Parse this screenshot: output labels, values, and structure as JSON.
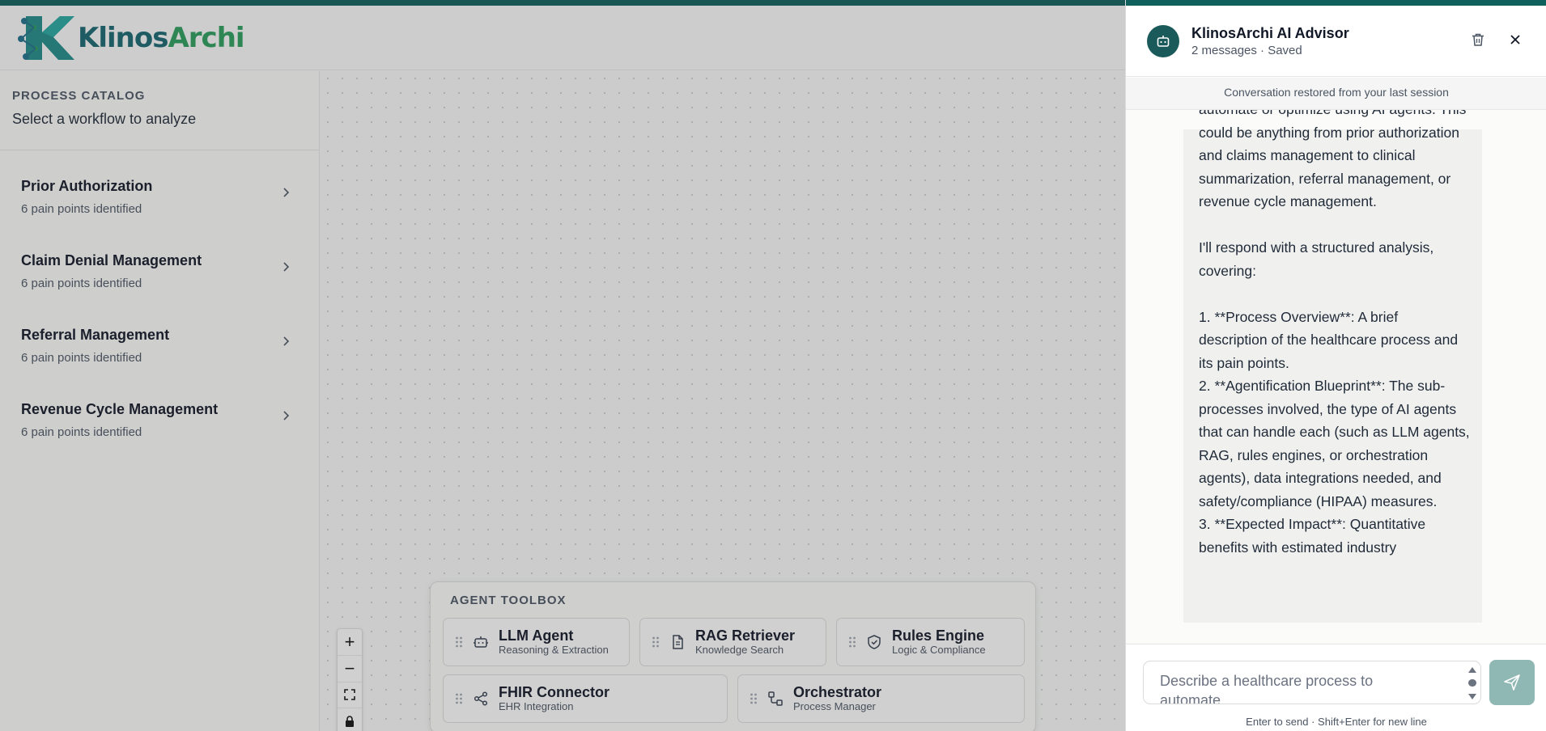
{
  "app": {
    "logo_text_a": "Klinos",
    "logo_text_b": "Archi"
  },
  "sidebar": {
    "kicker": "PROCESS CATALOG",
    "subtitle": "Select a workflow to analyze",
    "items": [
      {
        "title": "Prior Authorization",
        "meta": "6 pain points identified"
      },
      {
        "title": "Claim Denial Management",
        "meta": "6 pain points identified"
      },
      {
        "title": "Referral Management",
        "meta": "6 pain points identified"
      },
      {
        "title": "Revenue Cycle Management",
        "meta": "6 pain points identified"
      }
    ]
  },
  "zoom": {
    "zoom_in": "+",
    "zoom_out": "−"
  },
  "toolbox": {
    "title": "AGENT TOOLBOX",
    "tools": [
      {
        "name": "LLM Agent",
        "desc": "Reasoning & Extraction",
        "icon": "robot-icon"
      },
      {
        "name": "RAG Retriever",
        "desc": "Knowledge Search",
        "icon": "document-icon"
      },
      {
        "name": "Rules Engine",
        "desc": "Logic & Compliance",
        "icon": "shield-check-icon"
      },
      {
        "name": "FHIR Connector",
        "desc": "EHR Integration",
        "icon": "share-icon"
      },
      {
        "name": "Orchestrator",
        "desc": "Process Manager",
        "icon": "workflow-icon"
      }
    ]
  },
  "chat": {
    "title": "KlinosArchi AI Advisor",
    "status": "2 messages · Saved",
    "restored": "Conversation restored from your last session",
    "message": {
      "p1": "automate or optimize using AI agents. This could be anything from prior authorization and claims management to clinical summarization, referral management, or revenue cycle management.",
      "p2": "I'll respond with a structured analysis, covering:",
      "l1": "1. **Process Overview**: A brief description of the healthcare process and its pain points.",
      "l2": "2. **Agentification Blueprint**: The sub-processes involved, the type of AI agents that can handle each (such as LLM agents, RAG, rules engines, or orchestration agents), data integrations needed, and safety/compliance (HIPAA) measures.",
      "l3": "3. **Expected Impact**: Quantitative benefits with estimated industry"
    },
    "input_placeholder": "Describe a healthcare process to automate...",
    "hint": "Enter to send · Shift+Enter for new line"
  },
  "colors": {
    "brand": "#0f5f5c",
    "accent_green": "#2a9b5b",
    "send_button": "#8fb7b3"
  }
}
